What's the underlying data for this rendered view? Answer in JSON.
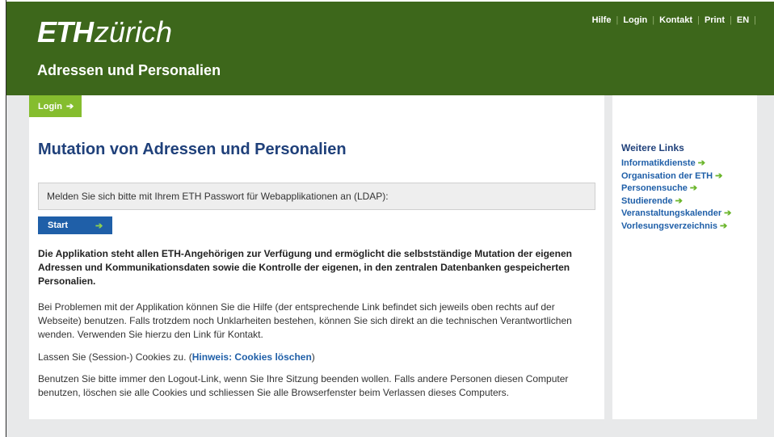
{
  "header": {
    "logo_eth": "ETH",
    "logo_zurich": "zürich",
    "site_title": "Adressen und Personalien",
    "meta_nav": [
      "Hilfe",
      "Login",
      "Kontakt",
      "Print",
      "EN"
    ]
  },
  "nav": {
    "login_tab": "Login",
    "arrow": "➔"
  },
  "main": {
    "heading": "Mutation von Adressen und Personalien",
    "ldap_prompt": "Melden Sie sich bitte mit Ihrem ETH Passwort für Webapplikationen an (LDAP):",
    "start_label": "Start",
    "intro_bold": "Die Applikation steht allen ETH-Angehörigen zur Verfügung und ermöglicht die selbstständige Mutation der eigenen Adressen und Kommunikationsdaten sowie die Kontrolle der eigenen, in den zentralen Datenbanken gespeicherten Personalien.",
    "problems_text": "Bei Problemen mit der Applikation können Sie die Hilfe (der entsprechende Link befindet sich jeweils oben rechts auf der Webseite) benutzen. Falls trotzdem noch Unklarheiten bestehen, können Sie sich direkt an die technischen Verantwortlichen wenden. Verwenden Sie hierzu den Link für Kontakt.",
    "cookies_prefix": "Lassen Sie (Session-) Cookies zu. (",
    "cookies_link": "Hinweis: Cookies löschen",
    "cookies_suffix": ")",
    "logout_text": "Benutzen Sie bitte immer den Logout-Link, wenn Sie Ihre Sitzung beenden wollen. Falls andere Personen diesen Computer benutzen, löschen sie alle Cookies und schliessen Sie alle Browserfenster beim Verlassen dieses Computers."
  },
  "sidebar": {
    "heading": "Weitere Links",
    "links": [
      "Informatikdienste",
      "Organisation der ETH",
      "Personensuche",
      "Studierende",
      "Veranstaltungskalender",
      "Vorlesungsverzeichnis"
    ]
  },
  "colors": {
    "header_green": "#3d671b",
    "tab_green": "#85bd2e",
    "link_blue": "#1f5fa8",
    "heading_blue": "#1f407a"
  },
  "icons": {
    "arrow": "arrow-right-icon"
  }
}
